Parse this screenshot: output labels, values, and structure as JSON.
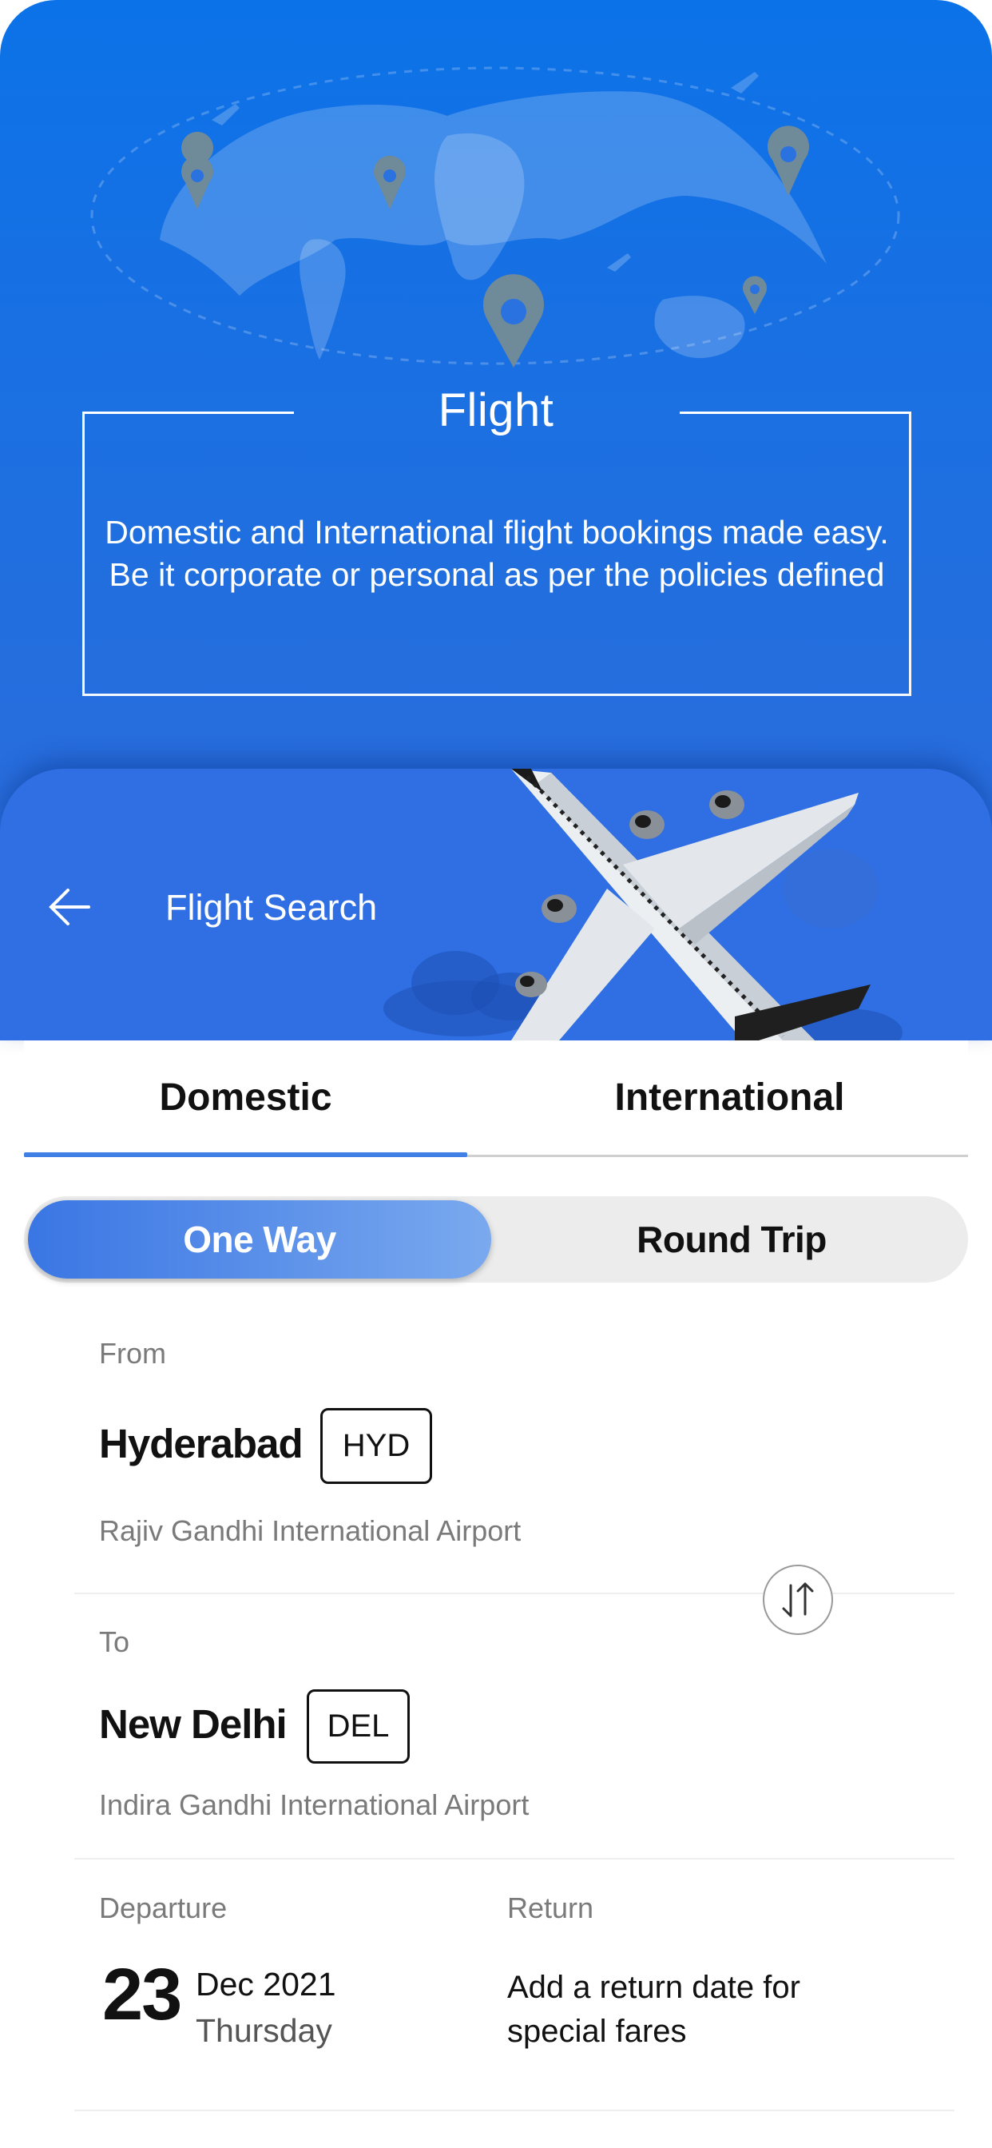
{
  "hero": {
    "title": "Flight",
    "description": "Domestic and International flight bookings made easy. Be it corporate or personal as per the policies defined"
  },
  "search": {
    "title": "Flight Search"
  },
  "tabs": [
    {
      "label": "Domestic",
      "selected": true
    },
    {
      "label": "International",
      "selected": false
    }
  ],
  "trip_type": {
    "one_way": "One Way",
    "round_trip": "Round Trip",
    "selected": "One Way"
  },
  "from": {
    "label": "From",
    "city": "Hyderabad",
    "code": "HYD",
    "airport": "Rajiv Gandhi International Airport"
  },
  "to": {
    "label": "To",
    "city": "New Delhi",
    "code": "DEL",
    "airport": "Indira Gandhi International Airport"
  },
  "departure": {
    "label": "Departure",
    "day": "23",
    "month_year": "Dec 2021",
    "weekday": "Thursday"
  },
  "return": {
    "label": "Return",
    "hint": "Add a return date for special fares"
  },
  "colors": {
    "hero_blue": "#0c72e8",
    "card_blue": "#2f6fe3",
    "accent": "#3f7fe6",
    "pin_gray": "#6f8a99"
  },
  "icons": [
    "world-map-icon",
    "location-pin-icon",
    "back-arrow-icon",
    "airplane-icon",
    "cloud-icon",
    "swap-icon"
  ]
}
